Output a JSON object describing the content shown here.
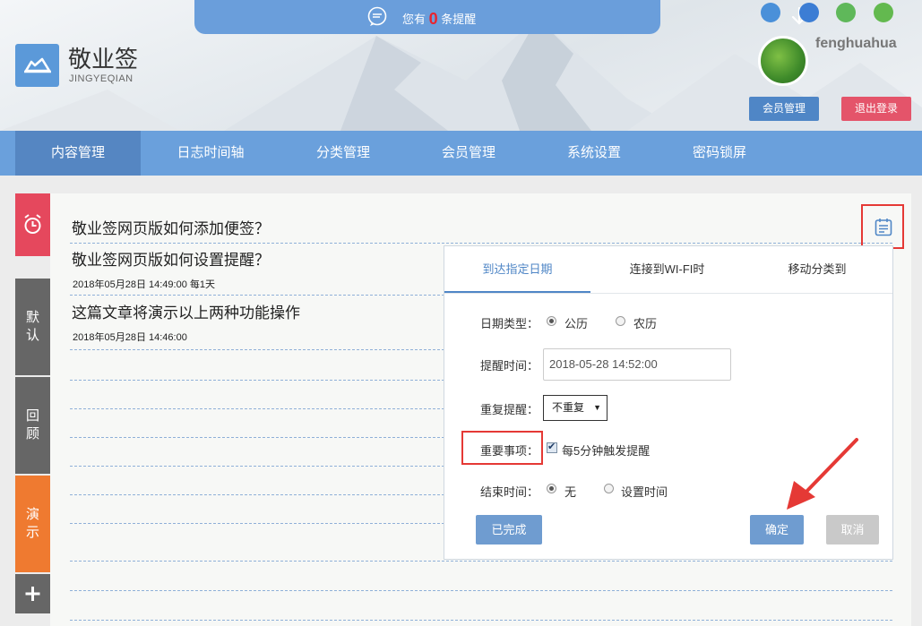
{
  "notice": {
    "prefix": "您有",
    "count": "0",
    "suffix": "条提醒"
  },
  "logo": {
    "title": "敬业签",
    "subtitle": "JINGYEQIAN"
  },
  "os_icons": [
    "ie-icon",
    "windows-icon",
    "apple-icon",
    "android-icon"
  ],
  "user": {
    "name": "fenghuahua",
    "member_btn": "会员管理",
    "logout_btn": "退出登录"
  },
  "nav": [
    "内容管理",
    "日志时间轴",
    "分类管理",
    "会员管理",
    "系统设置",
    "密码锁屏"
  ],
  "side": {
    "default_1": "默",
    "default_2": "认",
    "review_1": "回",
    "review_2": "顾",
    "demo_1": "演",
    "demo_2": "示"
  },
  "notes": [
    {
      "title": "敬业签网页版如何添加便签？",
      "meta": ""
    },
    {
      "title": "敬业签网页版如何设置提醒？",
      "meta": "2018年05月28日 14:49:00 每1天"
    },
    {
      "title": "这篇文章将演示以上两种功能操作",
      "meta": "2018年05月28日 14:46:00"
    }
  ],
  "popup": {
    "tabs": [
      "到达指定日期",
      "连接到WI-FI时",
      "移动分类到"
    ],
    "date_type_label": "日期类型：",
    "date_solar": "公历",
    "date_lunar": "农历",
    "remind_time_label": "提醒时间：",
    "remind_time_value": "2018-05-28 14:52:00",
    "repeat_label": "重复提醒：",
    "repeat_value": "不重复",
    "important_label": "重要事项：",
    "important_text": "每5分钟触发提醒",
    "end_label": "结束时间：",
    "end_none": "无",
    "end_set": "设置时间",
    "done_btn": "已完成",
    "ok_btn": "确定",
    "cancel_btn": "取消"
  },
  "colors": {
    "nav": "#6aa0dc",
    "nav_active": "#5586c2",
    "alert_red": "#e53935",
    "demo_orange": "#ef7a30",
    "accent_blue": "#4f86c6"
  }
}
